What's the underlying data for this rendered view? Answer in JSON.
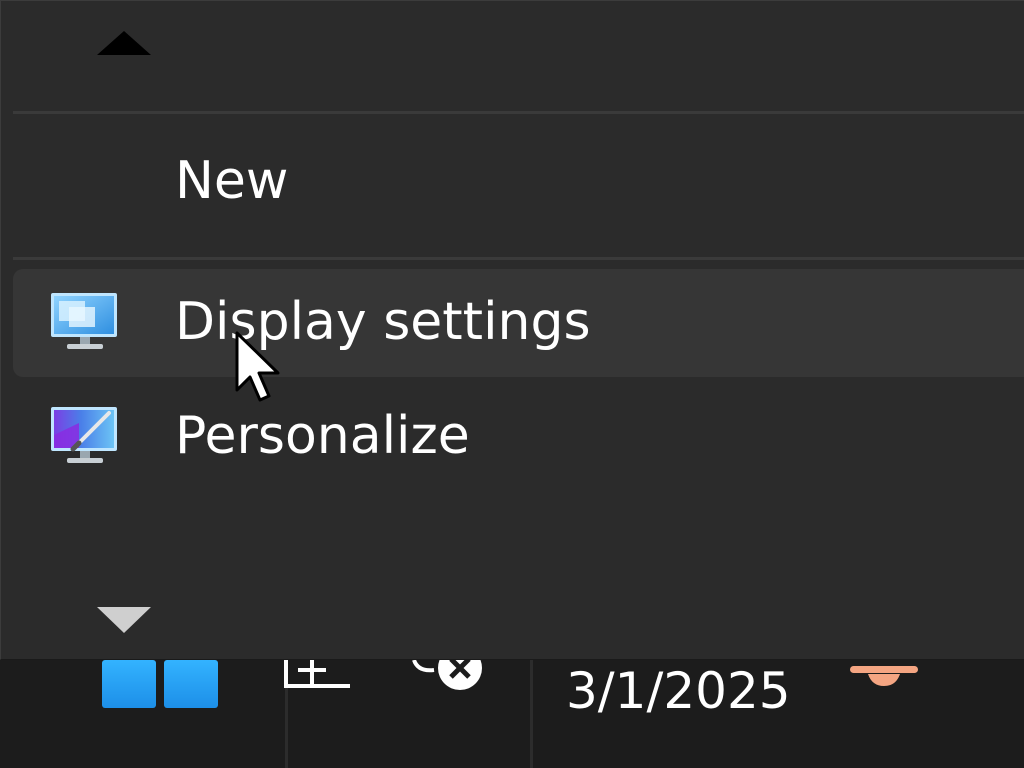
{
  "context_menu": {
    "items": [
      {
        "label": "New",
        "icon": "none",
        "hovered": false
      },
      {
        "label": "Display settings",
        "icon": "display-settings-icon",
        "hovered": true
      },
      {
        "label": "Personalize",
        "icon": "personalize-icon",
        "hovered": false
      }
    ],
    "scroll_up_icon": "triangle-up-icon",
    "scroll_down_icon": "triangle-down-icon"
  },
  "taskbar": {
    "start_icon": "windows-logo-icon",
    "date": "3/1/2025"
  },
  "colors": {
    "menu_background": "#2b2b2b",
    "menu_hover": "#363636",
    "taskbar_background": "#1c1c1c",
    "text": "#ffffff",
    "start_blue": "#3fa9f5",
    "notification_accent": "#f4a582"
  }
}
